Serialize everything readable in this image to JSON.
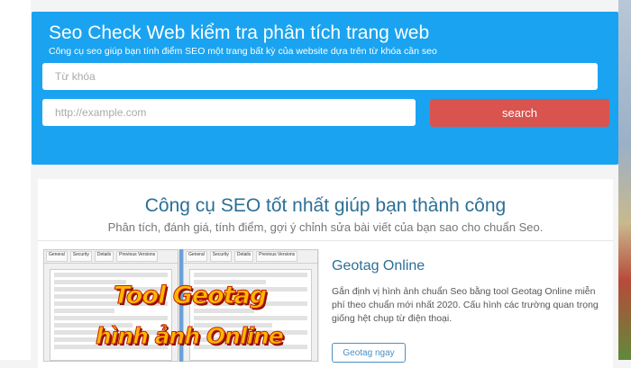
{
  "hero": {
    "title": "Seo Check Web kiểm tra phân tích trang web",
    "subtitle": "Công cụ seo giúp bạn tính điểm SEO một trang bất kỳ của website dựa trên từ khóa cần seo",
    "keyword_placeholder": "Từ khóa",
    "url_placeholder": "http://example.com",
    "search_label": "search",
    "background": "#1aa3f0",
    "button_color": "#d9534f"
  },
  "section": {
    "title": "Công cụ SEO tốt nhất giúp bạn thành công",
    "subtitle": "Phân tích, đánh giá, tính điểm, gợi ý chỉnh sửa bài viết của bạn sao cho chuẩn Seo."
  },
  "tool_card": {
    "thumbnail_title_line1": "Tool Geotag",
    "thumbnail_title_line2": "hình ảnh Online",
    "title": "Geotag Online",
    "description": "Gắn định vị hình ảnh chuẩn Seo bằng tool Geotag Online miễn phí theo chuẩn mới nhất 2020. Cấu hình các trường quan trọng giống hệt chụp từ điện thoại.",
    "button_label": "Geotag ngay"
  }
}
